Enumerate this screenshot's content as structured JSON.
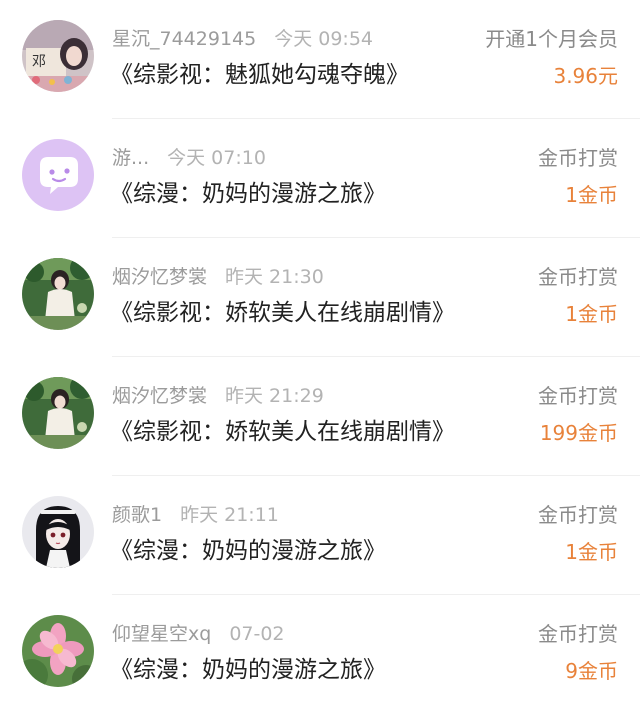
{
  "colors": {
    "amount": "#e8823a",
    "meta": "#9b9b9b",
    "title": "#222222"
  },
  "items": [
    {
      "username": "星沉_74429145",
      "time": "今天 09:54",
      "book_title": "《综影视：魅狐她勾魂夺魄》",
      "type": "开通1个月会员",
      "amount": "3.96元",
      "avatar": "user-photo-avatar",
      "avatar_text": "邓"
    },
    {
      "username": "游...",
      "time": "今天 07:10",
      "book_title": "《综漫：奶妈的漫游之旅》",
      "type": "金币打赏",
      "amount": "1金币",
      "avatar": "purple-chat-bubble-avatar"
    },
    {
      "username": "烟汐忆梦裳",
      "time": "昨天 21:30",
      "book_title": "《综影视：娇软美人在线崩剧情》",
      "type": "金币打赏",
      "amount": "1金币",
      "avatar": "garden-photo-avatar"
    },
    {
      "username": "烟汐忆梦裳",
      "time": "昨天 21:29",
      "book_title": "《综影视：娇软美人在线崩剧情》",
      "type": "金币打赏",
      "amount": "199金币",
      "avatar": "garden-photo-avatar"
    },
    {
      "username": "颜歌1",
      "time": "昨天 21:11",
      "book_title": "《综漫：奶妈的漫游之旅》",
      "type": "金币打赏",
      "amount": "1金币",
      "avatar": "anime-girl-avatar"
    },
    {
      "username": "仰望星空xq",
      "time": "07-02",
      "book_title": "《综漫：奶妈的漫游之旅》",
      "type": "金币打赏",
      "amount": "9金币",
      "avatar": "pink-flower-avatar"
    }
  ]
}
